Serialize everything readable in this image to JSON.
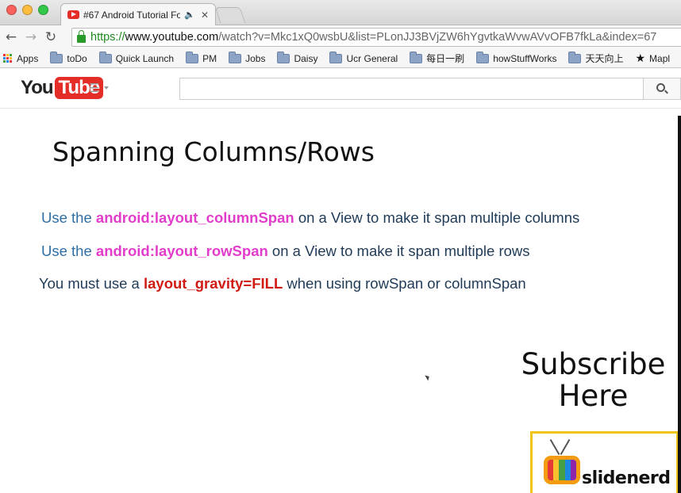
{
  "window": {
    "tab_title": "#67 Android Tutorial Fo",
    "tab_close": "✕",
    "speaker_icon": "🔈"
  },
  "nav": {
    "back_icon": "←",
    "forward_icon": "→",
    "reload_icon": "↻",
    "url_scheme": "https://",
    "url_host": "www.youtube.com",
    "url_rest": "/watch?v=Mkc1xQ0wsbU&list=PLonJJ3BVjZW6hYgvtkaWvwAVvOFB7fkLa&index=67"
  },
  "bookmarks": {
    "apps_label": "Apps",
    "apps_colors": [
      "#e53935",
      "#fbc02d",
      "#43a047",
      "#1e88e5",
      "#e53935",
      "#fbc02d",
      "#43a047",
      "#1e88e5",
      "#e53935"
    ],
    "items": [
      {
        "label": "toDo"
      },
      {
        "label": "Quick Launch"
      },
      {
        "label": "PM"
      },
      {
        "label": "Jobs"
      },
      {
        "label": "Daisy"
      },
      {
        "label": "Ucr General"
      },
      {
        "label": "每日一刷"
      },
      {
        "label": "howStuffWorks"
      },
      {
        "label": "天天向上"
      }
    ],
    "last_item": "Mapl",
    "last_icon": "★"
  },
  "youtube": {
    "logo_you": "You",
    "logo_tube": "Tube",
    "guide_icon": "☰",
    "search_placeholder": ""
  },
  "slide": {
    "title": "Spanning Columns/Rows",
    "line1": {
      "pre": "Use the ",
      "keyword": "android:layout_columnSpan",
      "post": " on a View to make it span multiple columns"
    },
    "line2": {
      "pre": "Use the ",
      "keyword": "android:layout_rowSpan",
      "post": " on a View to make it span multiple rows"
    },
    "line3": {
      "pre": "You must use a ",
      "keyword": "layout_gravity=FILL",
      "post": " when using rowSpan or columnSpan"
    },
    "subscribe_line1": "Subscribe",
    "subscribe_line2": "Here",
    "brand_name": "slidenerd",
    "tv_colors": [
      "#e53935",
      "#fbc02d",
      "#43a047",
      "#1e88e5",
      "#8e24aa"
    ]
  }
}
